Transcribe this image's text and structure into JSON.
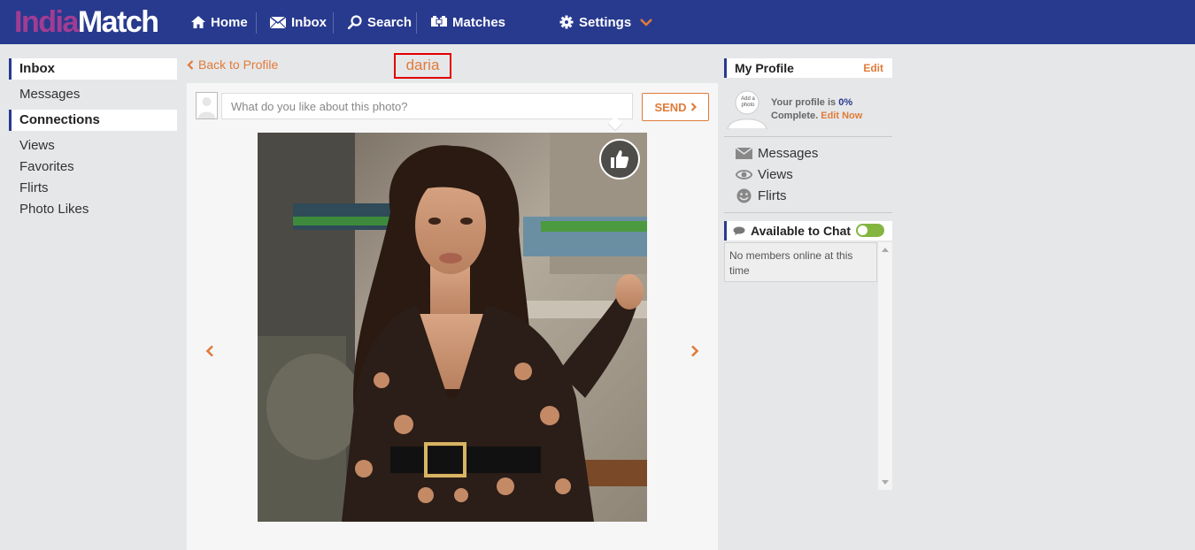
{
  "header": {
    "logo_part1": "India",
    "logo_part2": "Match",
    "nav": {
      "home": "Home",
      "inbox": "Inbox",
      "search": "Search",
      "matches": "Matches",
      "settings": "Settings"
    }
  },
  "left_nav": {
    "inbox_heading": "Inbox",
    "messages": "Messages",
    "connections_heading": "Connections",
    "views": "Views",
    "favorites": "Favorites",
    "flirts": "Flirts",
    "photo_likes": "Photo Likes"
  },
  "main": {
    "back_link": "Back to Profile",
    "profile_name": "daria",
    "comment_placeholder": "What do you like about this photo?",
    "send_label": "SEND"
  },
  "right_panel": {
    "my_profile_title": "My Profile",
    "edit_label": "Edit",
    "add_photo_label": "Add a photo",
    "profile_status_prefix": "Your profile is",
    "profile_percent": "0%",
    "profile_status_suffix": "Complete.",
    "edit_now_label": "Edit Now",
    "links": {
      "messages": "Messages",
      "views": "Views",
      "flirts": "Flirts"
    },
    "chat_title": "Available to Chat",
    "chat_empty": "No members online at this time"
  },
  "colors": {
    "header_bg": "#283a8e",
    "accent_orange": "#e07b39",
    "logo_purple": "#a23c93",
    "toggle_green": "#84b541"
  }
}
